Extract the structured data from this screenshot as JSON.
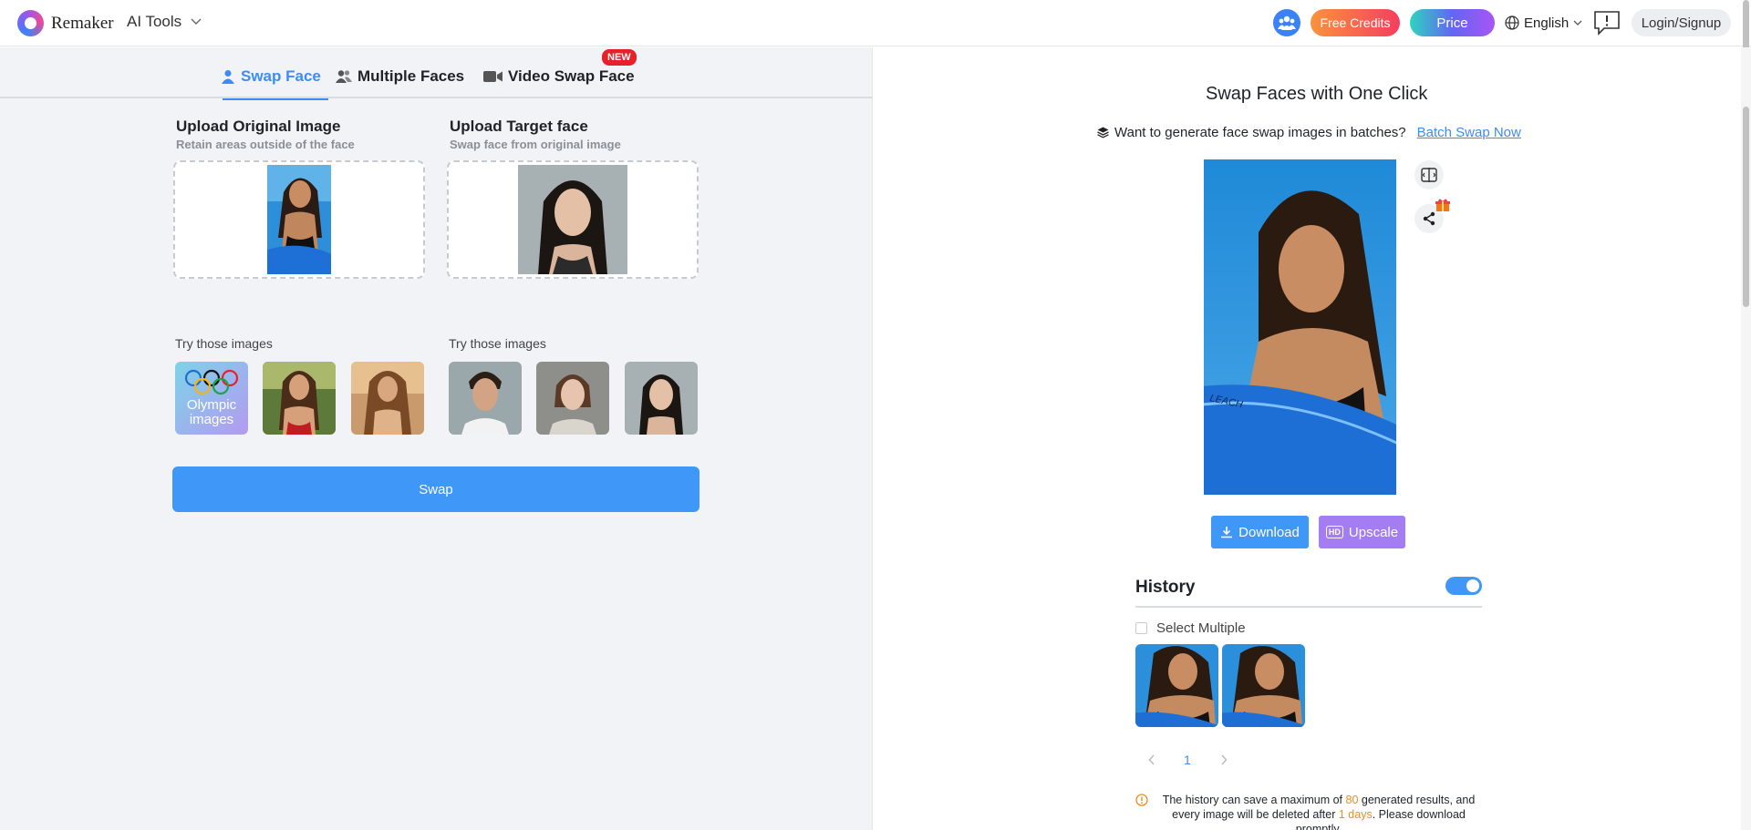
{
  "header": {
    "brand": "Remaker",
    "ai_tools": "AI Tools",
    "free_credits": "Free Credits",
    "price": "Price",
    "language": "English",
    "login": "Login/Signup"
  },
  "tabs": [
    {
      "label": "Swap Face",
      "icon": "person-icon"
    },
    {
      "label": "Multiple Faces",
      "icon": "people-icon"
    },
    {
      "label": "Video Swap Face",
      "icon": "video-icon",
      "badge": "NEW"
    }
  ],
  "upload_original": {
    "title": "Upload Original Image",
    "subtitle": "Retain areas outside of the face",
    "try_label": "Try those images"
  },
  "upload_target": {
    "title": "Upload Target face",
    "subtitle": "Swap face from original image",
    "try_label": "Try those images"
  },
  "sample_original": {
    "olympic_label": "Olympic images"
  },
  "swap_button": "Swap",
  "result": {
    "title": "Swap Faces with One Click",
    "batch_prompt": "Want to generate face swap images in batches?",
    "batch_link": "Batch Swap Now",
    "download": "Download",
    "upscale": "Upscale",
    "upscale_badge": "HD"
  },
  "history": {
    "title": "History",
    "toggle_on": true,
    "select_multiple": "Select Multiple",
    "page": "1",
    "note_part1": "The history can save a maximum of ",
    "note_max": "80",
    "note_part2": " generated results, and every image will be deleted after ",
    "note_days": "1 days",
    "note_part3": ". Please download promptly."
  },
  "colors": {
    "accent": "#3f97f7",
    "upscale": "#a57df2",
    "new_badge": "#e8202a",
    "highlight": "#f08c1e"
  }
}
